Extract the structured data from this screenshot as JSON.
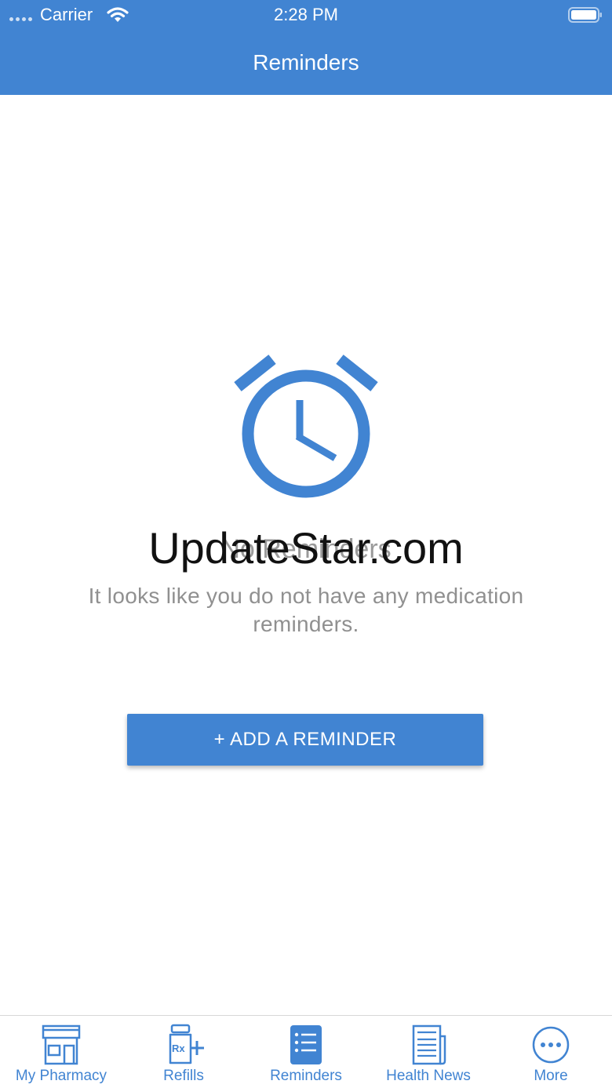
{
  "status_bar": {
    "carrier": "Carrier",
    "time": "2:28 PM"
  },
  "header": {
    "title": "Reminders"
  },
  "empty_state": {
    "icon": "alarm-clock-icon",
    "title": "No Reminders",
    "subtitle": "It looks like you do not have any medication reminders.",
    "button_label": "+ ADD A REMINDER"
  },
  "watermark": "UpdateStar.com",
  "tab_bar": {
    "active": "Reminders",
    "items": [
      {
        "label": "My Pharmacy",
        "icon": "storefront-icon"
      },
      {
        "label": "Refills",
        "icon": "rx-bottle-icon"
      },
      {
        "label": "Reminders",
        "icon": "list-icon"
      },
      {
        "label": "Health News",
        "icon": "newspaper-icon"
      },
      {
        "label": "More",
        "icon": "more-icon"
      }
    ]
  },
  "colors": {
    "accent": "#4184d2",
    "header_text": "#ffffff",
    "muted_text": "#909090"
  }
}
